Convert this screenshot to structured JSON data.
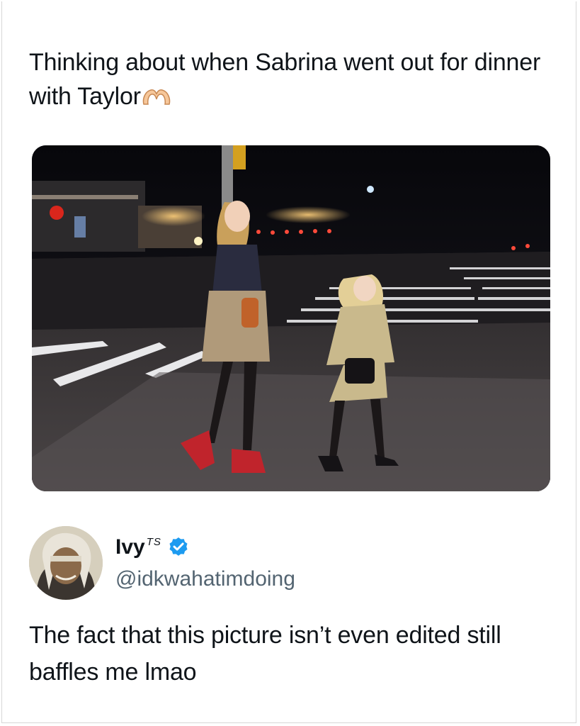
{
  "quoted_tweet": {
    "text": "Thinking about when Sabrina went out for dinner with Taylor",
    "emoji_icon": "heart-hands-icon"
  },
  "reply": {
    "display_name": "Ivy",
    "name_superscript": "TS",
    "handle": "@idkwahatimdoing",
    "verified_icon": "verified-badge-icon",
    "text": "The fact that this picture isn’t even edited still baffles me lmao"
  },
  "colors": {
    "verified": "#1d9bf0",
    "text": "#0f1419",
    "handle": "#536471"
  }
}
